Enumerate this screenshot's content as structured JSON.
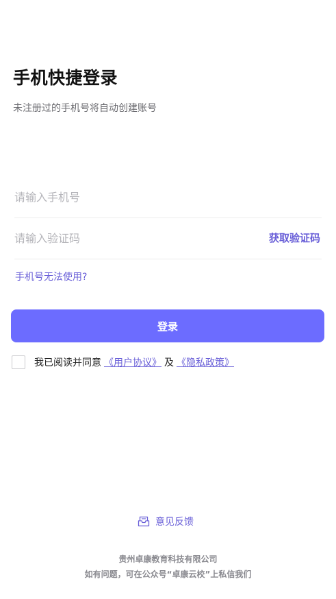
{
  "header": {
    "title": "手机快捷登录",
    "subtitle": "未注册过的手机号将自动创建账号"
  },
  "form": {
    "phone_placeholder": "请输入手机号",
    "phone_value": "",
    "code_placeholder": "请输入验证码",
    "code_value": "",
    "get_code_label": "获取验证码",
    "phone_help_label": "手机号无法使用?",
    "login_label": "登录"
  },
  "agreement": {
    "prefix": "我已阅读并同意",
    "user_agreement": "《用户协议》",
    "joiner": "及",
    "privacy_policy": "《隐私政策》",
    "checked": false
  },
  "feedback": {
    "label": "意见反馈",
    "icon": "mailbox-icon"
  },
  "footer": {
    "company": "贵州卓康教育科技有限公司",
    "contact": "如有问题，可在公众号“卓康云校”上私信我们"
  },
  "colors": {
    "accent": "#6a60d8",
    "button": "#6c6cff",
    "muted": "#6b6b70",
    "placeholder": "#b5b5ba"
  }
}
